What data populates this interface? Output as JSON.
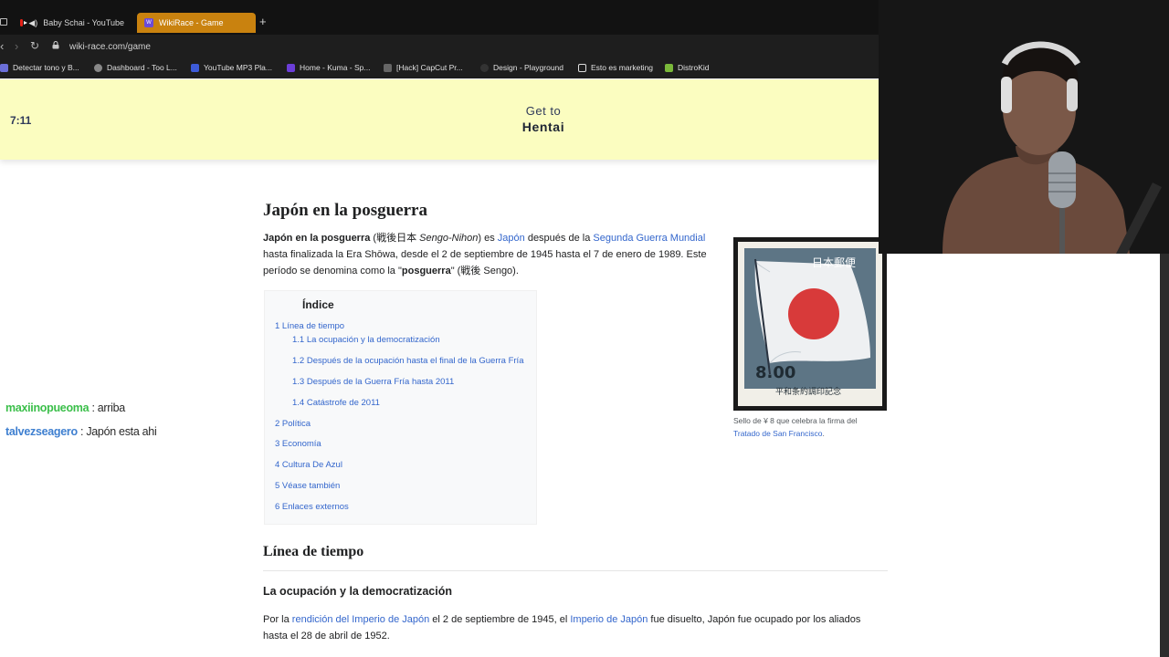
{
  "browser": {
    "tabs": [
      {
        "title": "Baby Schai - YouTube",
        "active": false
      },
      {
        "title": "WikiRace - Game",
        "active": true
      }
    ],
    "new_tab": "+",
    "url": "wiki-race.com/game",
    "bookmarks": [
      {
        "label": "Detectar tono y B...",
        "icon": "v-icon",
        "color": "#6b6fd8"
      },
      {
        "label": "Dashboard - Too L...",
        "icon": "plug-icon",
        "color": "#bbbbbb"
      },
      {
        "label": "YouTube MP3 Pla...",
        "icon": "f-icon",
        "color": "#3d5bd8"
      },
      {
        "label": "Home - Kuma - Sp...",
        "icon": "kuma-icon",
        "color": "#6c3ed8"
      },
      {
        "label": "[Hack] CapCut Pr...",
        "icon": "capcut-icon",
        "color": "#666666"
      },
      {
        "label": "Design - Playground",
        "icon": "playground-icon",
        "color": "#333333"
      },
      {
        "label": "Esto es marketing",
        "icon": "doc-icon",
        "color": "#dddddd"
      },
      {
        "label": "DistroKid",
        "icon": "distrokid-icon",
        "color": "#7ab83a"
      }
    ]
  },
  "game": {
    "timer": "7:11",
    "goal_label": "Get to",
    "goal_target": "Hentai"
  },
  "article": {
    "title": "Japón en la posguerra",
    "intro": {
      "bold_title": "Japón en la posguerra",
      "paren_open": " (戦後日本 ",
      "romaji": "Sengo-Nihon",
      "paren_close": ") es ",
      "link_japon": "Japón",
      "after_japon": " después de la ",
      "link_guerra": "Segunda Guerra Mundial",
      "line2": "hasta finalizada la Era Shōwa, desde el 2 de septiembre de 1945 hasta el 7 de enero de 1989. Este",
      "line3_start": "período se denomina como la \"",
      "line3_bold": "posguerra",
      "line3_end": "\" (戦後 Sengo)."
    },
    "toc": {
      "title": "Índice",
      "items": [
        {
          "label": "1 Línea de tiempo",
          "level": 1
        },
        {
          "label": "1.1 La ocupación y la democratización",
          "level": 2
        },
        {
          "label": "1.2 Después de la ocupación hasta el final de la Guerra Fría",
          "level": 2
        },
        {
          "label": "1.3 Después de la Guerra Fría hasta 2011",
          "level": 2
        },
        {
          "label": "1.4 Catástrofe de 2011",
          "level": 2
        },
        {
          "label": "2 Política",
          "level": 1
        },
        {
          "label": "3 Economía",
          "level": 1
        },
        {
          "label": "4 Cultura De Azul",
          "level": 1
        },
        {
          "label": "5 Véase también",
          "level": 1
        },
        {
          "label": "6 Enlaces externos",
          "level": 1
        }
      ]
    },
    "figure": {
      "stamp_top_text": "日本郵便",
      "stamp_value": "8.00",
      "stamp_bottom_text": "平和条約調印記念",
      "caption_text": "Sello de ¥ 8 que celebra la firma del",
      "caption_link": "Tratado de San Francisco",
      "caption_end": "."
    },
    "section_h2": "Línea de tiempo",
    "section_h3": "La ocupación y la democratización",
    "para2": {
      "start": "Por la ",
      "link1": "rendición del Imperio de Japón",
      "mid1": " el 2 de septiembre de 1945, el ",
      "link2": "Imperio de Japón",
      "mid2": " fue disuelto, Japón fue ocupado por los aliados",
      "line2": "hasta el 28 de abril de 1952."
    }
  },
  "chat": [
    {
      "user": "maxiinopueoma",
      "message": " : arriba"
    },
    {
      "user": "talvezseagero",
      "message": " : Japón esta ahi"
    }
  ]
}
